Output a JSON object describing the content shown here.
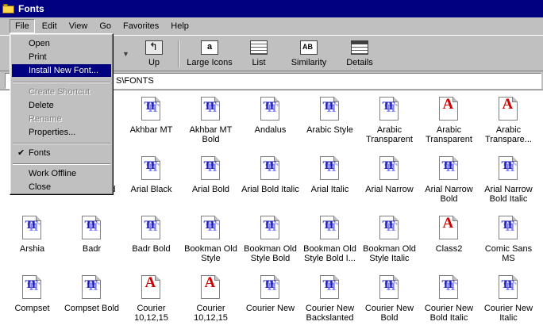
{
  "window": {
    "title": "Fonts",
    "icon": "folder-icon"
  },
  "menubar": [
    "File",
    "Edit",
    "View",
    "Go",
    "Favorites",
    "Help"
  ],
  "toolbar": {
    "up": "Up",
    "large_icons": "Large Icons",
    "list": "List",
    "similarity": "Similarity",
    "details": "Details"
  },
  "address": {
    "value": "S\\FONTS"
  },
  "file_menu": {
    "open": "Open",
    "print": "Print",
    "install": "Install New Font...",
    "create_shortcut": "Create Shortcut",
    "delete": "Delete",
    "rename": "Rename",
    "properties": "Properties...",
    "fonts": "Fonts",
    "work_offline": "Work Offline",
    "close": "Close"
  },
  "fonts": [
    {
      "label": "",
      "icon": "tt"
    },
    {
      "label": "",
      "icon": "tt"
    },
    {
      "label": "Akhbar MT",
      "icon": "tt"
    },
    {
      "label": "Akhbar MT Bold",
      "icon": "tt"
    },
    {
      "label": "Andalus",
      "icon": "tt"
    },
    {
      "label": "Arabic Style",
      "icon": "tt"
    },
    {
      "label": "Arabic Transparent",
      "icon": "tt"
    },
    {
      "label": "Arabic Transparent",
      "icon": "a"
    },
    {
      "label": "Arabic Transpare...",
      "icon": "a"
    },
    {
      "label": "",
      "icon": "tt"
    },
    {
      "label": "Backslanted",
      "icon": "tt"
    },
    {
      "label": "Arial Black",
      "icon": "tt"
    },
    {
      "label": "Arial Bold",
      "icon": "tt"
    },
    {
      "label": "Arial Bold Italic",
      "icon": "tt"
    },
    {
      "label": "Arial Italic",
      "icon": "tt"
    },
    {
      "label": "Arial Narrow",
      "icon": "tt"
    },
    {
      "label": "Arial Narrow Bold",
      "icon": "tt"
    },
    {
      "label": "Arial Narrow Bold Italic",
      "icon": "tt"
    },
    {
      "label": "Arshia",
      "icon": "tt"
    },
    {
      "label": "Badr",
      "icon": "tt"
    },
    {
      "label": "Badr Bold",
      "icon": "tt"
    },
    {
      "label": "Bookman Old Style",
      "icon": "tt"
    },
    {
      "label": "Bookman Old Style Bold",
      "icon": "tt"
    },
    {
      "label": "Bookman Old Style Bold I...",
      "icon": "tt"
    },
    {
      "label": "Bookman Old Style Italic",
      "icon": "tt"
    },
    {
      "label": "Class2",
      "icon": "a"
    },
    {
      "label": "Comic Sans MS",
      "icon": "tt"
    },
    {
      "label": "Compset",
      "icon": "tt"
    },
    {
      "label": "Compset Bold",
      "icon": "tt"
    },
    {
      "label": "Courier 10,12,15",
      "icon": "a"
    },
    {
      "label": "Courier 10,12,15",
      "icon": "a"
    },
    {
      "label": "Courier New",
      "icon": "tt"
    },
    {
      "label": "Courier New Backslanted",
      "icon": "tt"
    },
    {
      "label": "Courier New Bold",
      "icon": "tt"
    },
    {
      "label": "Courier New Bold Italic",
      "icon": "tt"
    },
    {
      "label": "Courier New Italic",
      "icon": "tt"
    }
  ]
}
